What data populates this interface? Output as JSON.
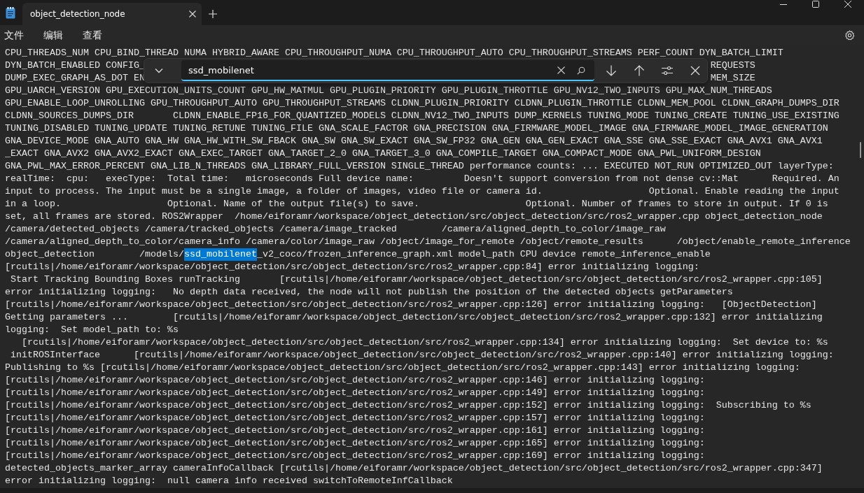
{
  "tabs": [
    {
      "label": "object_detection_node",
      "selected": true
    }
  ],
  "menu": [
    "文件",
    "编辑",
    "查看"
  ],
  "find": {
    "value": "ssd_mobilenet"
  },
  "lines": [
    {
      "kind": "plain",
      "text": "CPU_THREADS_NUM CPU_BIND_THREAD NUMA HYBRID_AWARE CPU_THROUGHPUT_NUMA CPU_THROUGHPUT_AUTO CPU_THROUGHPUT_STREAMS PERF_COUNT DYN_BATCH_LIMIT"
    },
    {
      "kind": "split",
      "left": "DYN_BATCH_ENABLED CONFIG_",
      "right": "REQUESTS"
    },
    {
      "kind": "split",
      "left": "DUMP_EXEC_GRAPH_AS_DOT EN",
      "right": "MEM_SIZE"
    },
    {
      "kind": "plain",
      "text": "GPU_UARCH_VERSION GPU_EXECUTION_UNITS_COUNT GPU_HW_MATMUL GPU_PLUGIN_PRIORITY GPU_PLUGIN_THROTTLE GPU_NV12_TWO_INPUTS GPU_MAX_NUM_THREADS"
    },
    {
      "kind": "plain",
      "text": "GPU_ENABLE_LOOP_UNROLLING GPU_THROUGHPUT_AUTO GPU_THROUGHPUT_STREAMS CLDNN_PLUGIN_PRIORITY CLDNN_PLUGIN_THROTTLE CLDNN_MEM_POOL CLDNN_GRAPH_DUMPS_DIR"
    },
    {
      "kind": "plain",
      "text": "CLDNN_SOURCES_DUMPS_DIR       CLDNN_ENABLE_FP16_FOR_QUANTIZED_MODELS CLDNN_NV12_TWO_INPUTS DUMP_KERNELS TUNING_MODE TUNING_CREATE TUNING_USE_EXISTING"
    },
    {
      "kind": "plain",
      "text": "TUNING_DISABLED TUNING_UPDATE TUNING_RETUNE TUNING_FILE GNA_SCALE_FACTOR GNA_PRECISION GNA_FIRMWARE_MODEL_IMAGE GNA_FIRMWARE_MODEL_IMAGE_GENERATION"
    },
    {
      "kind": "plain",
      "text": "GNA_DEVICE_MODE GNA_AUTO GNA_HW GNA_HW_WITH_SW_FBACK GNA_SW GNA_SW_EXACT GNA_SW_FP32 GNA_GEN GNA_GEN_EXACT GNA_SSE GNA_SSE_EXACT GNA_AVX1 GNA_AVX1"
    },
    {
      "kind": "plain",
      "text": "_EXACT GNA_AVX2 GNA_AVX2_EXACT GNA_EXEC_TARGET GNA_TARGET_2_0 GNA_TARGET_3_0 GNA_COMPILE_TARGET GNA_COMPACT_MODE GNA_PWL_UNIFORM_DESIGN"
    },
    {
      "kind": "plain",
      "text": "GNA_PWL_MAX_ERROR_PERCENT GNA_LIB_N_THREADS GNA_LIBRARY_FULL_VERSION SINGLE_THREAD performance counts: ... EXECUTED NOT_RUN OPTIMIZED_OUT layerType:"
    },
    {
      "kind": "plain",
      "text": "realTime:  cpu:   execType:  Total time:   microseconds Full device name:         Doesn't support conversion from not dense cv::Mat      Required. An"
    },
    {
      "kind": "plain",
      "text": "input to process. The input must be a single image, a folder of images, video file or camera id.                   Optional. Enable reading the input"
    },
    {
      "kind": "plain",
      "text": "in a loop.                   Optional. Name of the output file(s) to save.                   Optional. Number of frames to store in output. If 0 is"
    },
    {
      "kind": "plain",
      "text": "set, all frames are stored. ROS2Wrapper  /home/eiforamr/workspace/object_detection/src/object_detection/src/ros2_wrapper.cpp object_detection_node"
    },
    {
      "kind": "plain",
      "text": "/camera/detected_objects /camera/tracked_objects /camera/image_tracked        /camera/aligned_depth_to_color/image_raw"
    },
    {
      "kind": "plain",
      "text": "/camera/aligned_depth_to_color/camera_info /camera/color/image_raw /object/image_for_remote /object/remote_results      /object/enable_remote_inference"
    },
    {
      "kind": "match",
      "parts": [
        {
          "text": "object_detection        /models/",
          "highlighted": false
        },
        {
          "text": "ssd_mobilenet",
          "highlighted": true
        },
        {
          "text": "_v2_coco/frozen_inference_graph.xml model_path CPU device remote_inference_enable",
          "highlighted": false
        }
      ]
    },
    {
      "kind": "plain",
      "text": "[rcutils|/home/eiforamr/workspace/object_detection/src/object_detection/src/ros2_wrapper.cpp:84] error initializing logging:"
    },
    {
      "kind": "plain",
      "text": " Start Tracking Bounding Boxes runTracking       [rcutils|/home/eiforamr/workspace/object_detection/src/object_detection/src/ros2_wrapper.cpp:105]"
    },
    {
      "kind": "plain",
      "text": "error initializing logging:   No depth data received, the node will not publish the position of the detected objects getParameters"
    },
    {
      "kind": "plain",
      "text": "[rcutils|/home/eiforamr/workspace/object_detection/src/object_detection/src/ros2_wrapper.cpp:126] error initializing logging:   [ObjectDetection]"
    },
    {
      "kind": "plain",
      "text": "Getting parameters ...        [rcutils|/home/eiforamr/workspace/object_detection/src/object_detection/src/ros2_wrapper.cpp:132] error initializing"
    },
    {
      "kind": "plain",
      "text": "logging:  Set model_path to: %s"
    },
    {
      "kind": "plain",
      "text": "   [rcutils|/home/eiforamr/workspace/object_detection/src/object_detection/src/ros2_wrapper.cpp:134] error initializing logging:  Set device to: %s"
    },
    {
      "kind": "plain",
      "text": " initROSInterface      [rcutils|/home/eiforamr/workspace/object_detection/src/object_detection/src/ros2_wrapper.cpp:140] error initializing logging:"
    },
    {
      "kind": "plain",
      "text": "Publishing to %s [rcutils|/home/eiforamr/workspace/object_detection/src/object_detection/src/ros2_wrapper.cpp:143] error initializing logging:"
    },
    {
      "kind": "plain",
      "text": "[rcutils|/home/eiforamr/workspace/object_detection/src/object_detection/src/ros2_wrapper.cpp:146] error initializing logging:"
    },
    {
      "kind": "plain",
      "text": "[rcutils|/home/eiforamr/workspace/object_detection/src/object_detection/src/ros2_wrapper.cpp:149] error initializing logging:"
    },
    {
      "kind": "plain",
      "text": "[rcutils|/home/eiforamr/workspace/object_detection/src/object_detection/src/ros2_wrapper.cpp:152] error initializing logging:  Subscribing to %s"
    },
    {
      "kind": "plain",
      "text": "[rcutils|/home/eiforamr/workspace/object_detection/src/object_detection/src/ros2_wrapper.cpp:157] error initializing logging:"
    },
    {
      "kind": "plain",
      "text": "[rcutils|/home/eiforamr/workspace/object_detection/src/object_detection/src/ros2_wrapper.cpp:161] error initializing logging:"
    },
    {
      "kind": "plain",
      "text": "[rcutils|/home/eiforamr/workspace/object_detection/src/object_detection/src/ros2_wrapper.cpp:165] error initializing logging:"
    },
    {
      "kind": "plain",
      "text": "[rcutils|/home/eiforamr/workspace/object_detection/src/object_detection/src/ros2_wrapper.cpp:169] error initializing logging:"
    },
    {
      "kind": "plain",
      "text": "detected_objects_marker_array cameraInfoCallback [rcutils|/home/eiforamr/workspace/object_detection/src/object_detection/src/ros2_wrapper.cpp:347]"
    },
    {
      "kind": "plain",
      "text": "error initializing logging:  null camera info received switchToRemoteInfCallback"
    }
  ]
}
